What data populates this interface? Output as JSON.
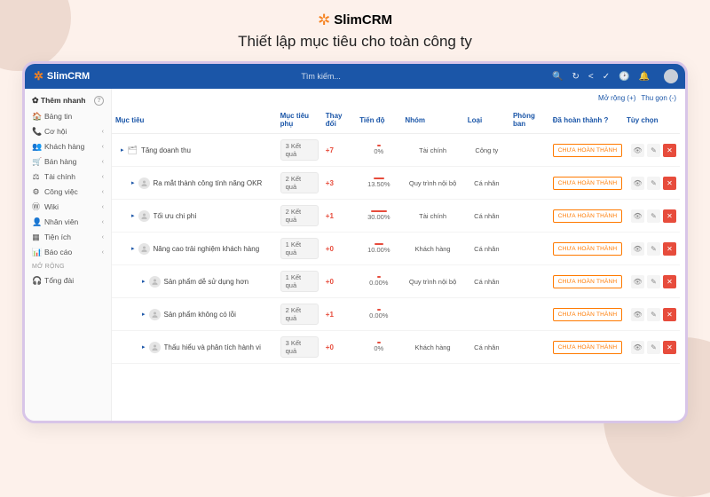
{
  "brand": {
    "name_pre": "Slim",
    "name_bold": "CRM"
  },
  "page_title": "Thiết lập mục tiêu cho toàn công ty",
  "app": {
    "search_placeholder": "Tìm kiếm...",
    "subheader": {
      "expand": "Mở rộng (+)",
      "collapse": "Thu gọn (-)"
    }
  },
  "sidebar": {
    "quick_add": "Thêm nhanh",
    "items": [
      {
        "icon": "home",
        "label": "Bảng tin",
        "caret": ""
      },
      {
        "icon": "phone",
        "label": "Cơ hội",
        "caret": "‹"
      },
      {
        "icon": "users",
        "label": "Khách hàng",
        "caret": "‹"
      },
      {
        "icon": "cart",
        "label": "Bán hàng",
        "caret": "‹"
      },
      {
        "icon": "scale",
        "label": "Tài chính",
        "caret": "‹"
      },
      {
        "icon": "gear",
        "label": "Công việc",
        "caret": "‹"
      },
      {
        "icon": "w",
        "label": "Wiki",
        "caret": "‹"
      },
      {
        "icon": "person",
        "label": "Nhân viên",
        "caret": "‹"
      },
      {
        "icon": "grid",
        "label": "Tiện ích",
        "caret": "‹"
      },
      {
        "icon": "chart",
        "label": "Báo cáo",
        "caret": "‹"
      }
    ],
    "section": "MỞ RỘNG",
    "extra": "Tổng đài"
  },
  "table": {
    "headers": {
      "objective": "Mục tiêu",
      "sub": "Mục tiêu phụ",
      "change": "Thay đổi",
      "progress": "Tiến độ",
      "group": "Nhóm",
      "type": "Loại",
      "dept": "Phòng ban",
      "done": "Đã hoàn thành ?",
      "options": "Tùy chọn"
    },
    "status_label": "CHƯA HOÀN THÀNH",
    "rows": [
      {
        "name": "Tăng doanh thu",
        "pill": "3 Kết quả",
        "change_n": 7,
        "change": "+7",
        "progress": "0%",
        "bar": 4,
        "group": "Tài chính",
        "type": "Công ty",
        "dept": "",
        "root": true,
        "indent": 0
      },
      {
        "name": "Ra mắt thành công tính năng OKR",
        "pill": "2 Kết quả",
        "change_n": 3,
        "change": "+3",
        "progress": "13.50%",
        "bar": 12,
        "group": "Quy trình nội bộ",
        "type": "Cá nhân",
        "dept": "",
        "indent": 1
      },
      {
        "name": "Tối ưu chi phí",
        "pill": "2 Kết quả",
        "change_n": 1,
        "change": "+1",
        "progress": "30.00%",
        "bar": 18,
        "group": "Tài chính",
        "type": "Cá nhân",
        "dept": "",
        "indent": 1
      },
      {
        "name": "Nâng cao trải nghiệm khách hàng",
        "pill": "1 Kết quả",
        "change_n": 0,
        "change": "+0",
        "progress": "10.00%",
        "bar": 10,
        "group": "Khách hàng",
        "type": "Cá nhân",
        "dept": "",
        "indent": 1
      },
      {
        "name": "Sản phẩm dễ sử dụng hơn",
        "pill": "1 Kết quả",
        "change_n": 0,
        "change": "+0",
        "progress": "0.00%",
        "bar": 4,
        "group": "Quy trình nội bộ",
        "type": "Cá nhân",
        "dept": "",
        "indent": 2
      },
      {
        "name": "Sản phẩm không có lỗi",
        "pill": "2 Kết quả",
        "change_n": 1,
        "change": "+1",
        "progress": "0.00%",
        "bar": 4,
        "group": "",
        "type": "",
        "dept": "",
        "indent": 2
      },
      {
        "name": "Thấu hiểu và phân tích hành vi",
        "pill": "3 Kết quả",
        "change_n": 0,
        "change": "+0",
        "progress": "0%",
        "bar": 4,
        "group": "Khách hàng",
        "type": "Cá nhân",
        "dept": "",
        "indent": 2
      }
    ]
  },
  "icon_map": {
    "home": "🏠",
    "phone": "📞",
    "users": "👥",
    "cart": "🛒",
    "scale": "⚖",
    "gear": "⚙",
    "w": "Ⓦ",
    "person": "👤",
    "grid": "▦",
    "chart": "📊",
    "headset": "🎧"
  }
}
